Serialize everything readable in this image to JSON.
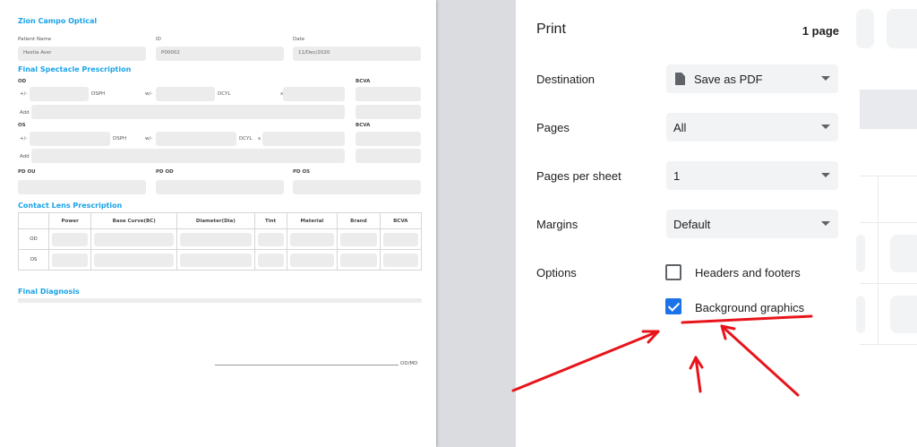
{
  "preview": {
    "clinic_title": "Zion Campo Optical",
    "patient_name_label": "Patient Name",
    "patient_name_value": "Hestia Aver",
    "id_label": "ID",
    "id_value": "P00002",
    "date_label": "Date",
    "date_value": "11/Dec/2020",
    "spectacle_heading": "Final Spectacle Prescription",
    "od_label": "OD",
    "os_label": "OS",
    "plus_minus": "+/-",
    "dsph": "DSPH",
    "w_minus": "w/-",
    "dcyl": "DCYL",
    "x": "x",
    "bcva": "BCVA",
    "add": "Add",
    "pd_ou": "PD OU",
    "pd_od": "PD OD",
    "pd_os": "PD OS",
    "contact_heading": "Contact Lens Prescription",
    "contact_columns": [
      "",
      "Power",
      "Base Curve(BC)",
      "Diameter(Dia)",
      "Tint",
      "Material",
      "Brand",
      "BCVA"
    ],
    "contact_rows": [
      "OD",
      "OS"
    ],
    "diagnosis_heading": "Final Diagnosis",
    "signature_label": "OD/MD"
  },
  "print": {
    "title": "Print",
    "page_count": "1 page",
    "destination_label": "Destination",
    "destination_value": "Save as PDF",
    "destination_icon": "document-icon",
    "pages_label": "Pages",
    "pages_value": "All",
    "pages_per_sheet_label": "Pages per sheet",
    "pages_per_sheet_value": "1",
    "margins_label": "Margins",
    "margins_value": "Default",
    "options_label": "Options",
    "headers_footers_label": "Headers and footers",
    "headers_footers_checked": false,
    "background_graphics_label": "Background graphics",
    "background_graphics_checked": true,
    "accent_color": "#1a73e8"
  },
  "annotation_color": "#e8141b"
}
